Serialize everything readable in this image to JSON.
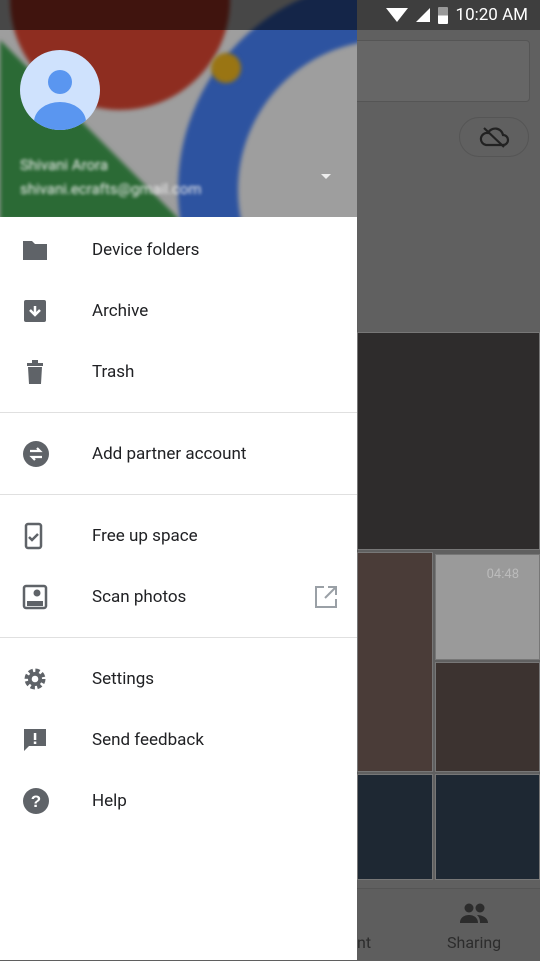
{
  "status_bar": {
    "time": "10:20 AM"
  },
  "account": {
    "name": "Shivani Arora",
    "email": "shivani.ecrafts@gmail.com"
  },
  "menu": {
    "group1": [
      {
        "label": "Device folders",
        "icon": "folder-icon"
      },
      {
        "label": "Archive",
        "icon": "archive-icon"
      },
      {
        "label": "Trash",
        "icon": "trash-icon"
      }
    ],
    "group2": [
      {
        "label": "Add partner account",
        "icon": "partner-swap-icon"
      }
    ],
    "group3": [
      {
        "label": "Free up space",
        "icon": "free-up-space-icon"
      },
      {
        "label": "Scan photos",
        "icon": "scan-photos-icon",
        "trailing": "open-external-icon"
      }
    ],
    "group4": [
      {
        "label": "Settings",
        "icon": "gear-icon"
      },
      {
        "label": "Send feedback",
        "icon": "feedback-icon"
      },
      {
        "label": "Help",
        "icon": "help-icon"
      }
    ]
  },
  "background": {
    "video_duration": "04:48",
    "nav_partial": "nt",
    "nav_sharing": "Sharing"
  }
}
